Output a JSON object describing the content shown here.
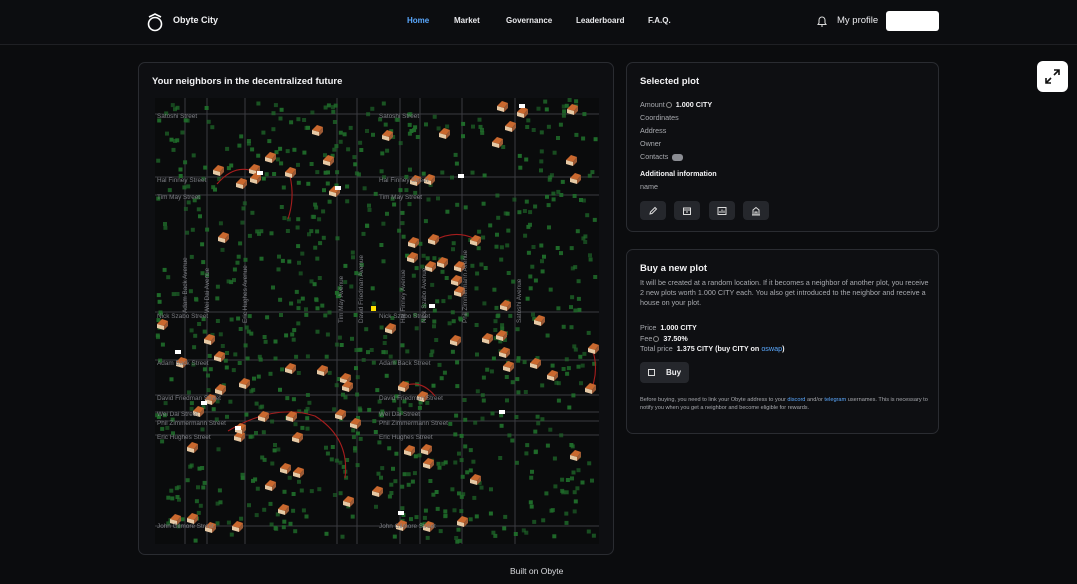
{
  "app": {
    "brand": "Obyte City"
  },
  "nav": {
    "links": [
      {
        "label": "Home",
        "active": true
      },
      {
        "label": "Market",
        "active": false
      },
      {
        "label": "Governance",
        "active": false
      },
      {
        "label": "Leaderboard",
        "active": false
      },
      {
        "label": "F.A.Q.",
        "active": false
      }
    ],
    "profile_label": "My profile",
    "login_button": ""
  },
  "map": {
    "title": "Your neighbors in the decentralized future",
    "streets_h": [
      "Satoshi Street",
      "Hal Finney Street",
      "Tim May Street",
      "Nick Szabo Street",
      "Adam Back Street",
      "David Friedman Street",
      "Wei Dai Street",
      "Phil Zimmermann Street",
      "Eric Hughes Street",
      "John Gilmore Street"
    ],
    "streets_v": [
      "Adam Back Avenue",
      "Wei Dai Avenue",
      "Eric Hughes Avenue",
      "Tim May Avenue",
      "David Friedman Avenue",
      "Hal Finney Avenue",
      "Nick Szabo Avenue",
      "Phil Zimmermann Avenue",
      "Satoshi Avenue"
    ]
  },
  "selected_plot": {
    "title": "Selected plot",
    "amount_label": "Amount",
    "amount_value": "1.000 CITY",
    "coordinates_label": "Coordinates",
    "address_label": "Address",
    "owner_label": "Owner",
    "contacts_label": "Contacts",
    "additional_title": "Additional information",
    "name_label": "name",
    "actions": [
      "edit-icon",
      "archive-icon",
      "chart-icon",
      "house-icon"
    ]
  },
  "buy": {
    "title": "Buy a new plot",
    "description": "It will be created at a random location. If it becomes a neighbor of another plot, you receive 2 new plots worth 1.000 CITY each. You also get introduced to the neighbor and receive a house on your plot.",
    "price_label": "Price",
    "price_value": "1.000 CITY",
    "fee_label": "Fee",
    "fee_value": "37.50%",
    "total_label": "Total price",
    "total_value": "1.375 CITY",
    "total_suffix_pre": "(buy CITY on ",
    "total_suffix_link": "oswap",
    "total_suffix_post": ")",
    "button_label": "Buy",
    "note_pre": "Before buying, you need to link your Obyte address to your ",
    "note_discord": "discord",
    "note_mid": " and/or ",
    "note_telegram": "telegram",
    "note_post": " usernames. This is necessary to notify you when you get a neighbor and become eligible for rewards."
  },
  "footer": {
    "text": "Built on Obyte"
  },
  "colors": {
    "accent": "#5aa9ff",
    "plot": "#1f6b2a",
    "house_roof": "#c9682e",
    "road": "#3a3b40"
  }
}
